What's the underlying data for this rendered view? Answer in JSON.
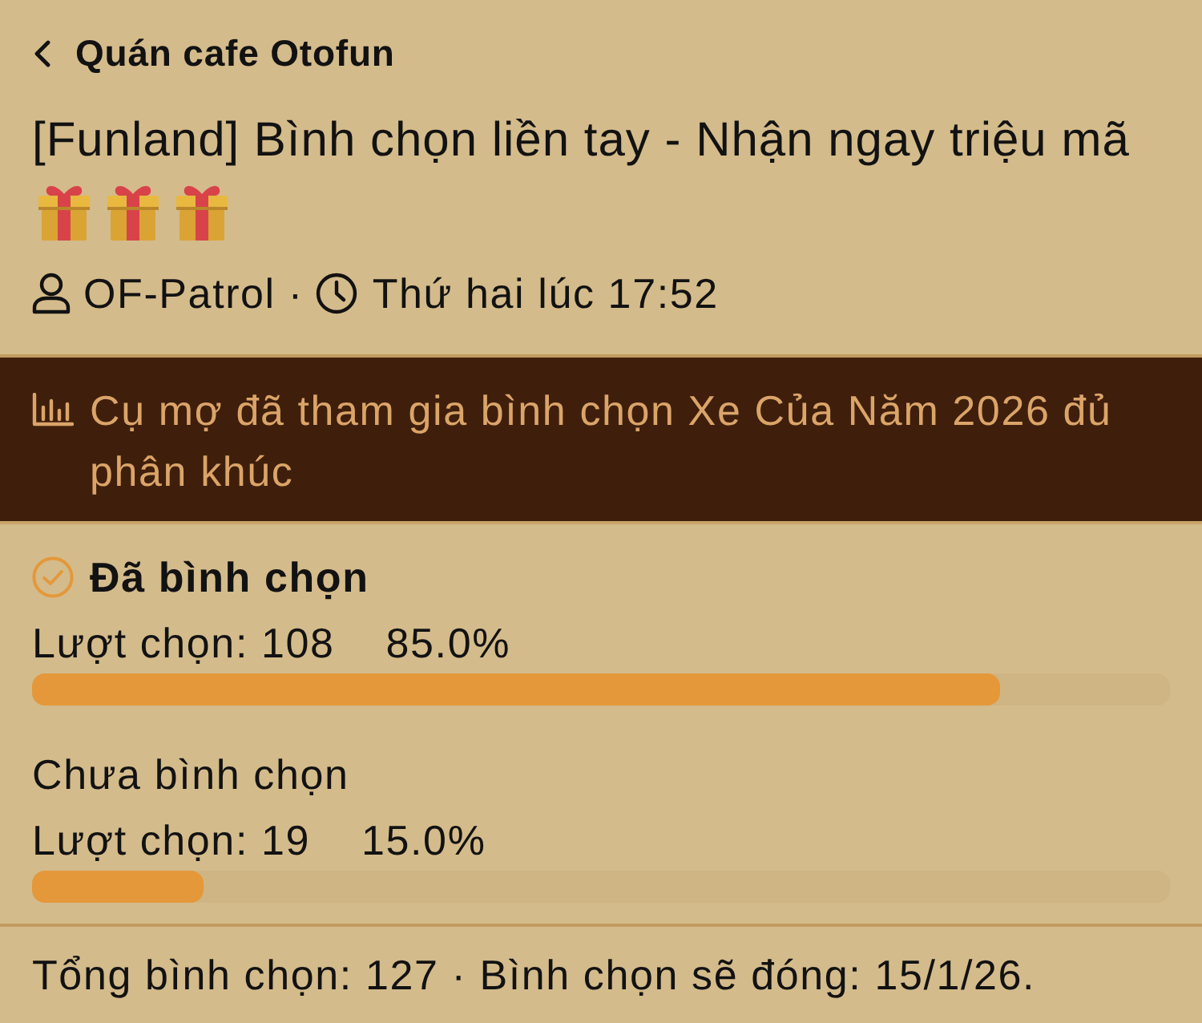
{
  "header": {
    "back_label": "Quán cafe Otofun"
  },
  "thread": {
    "title": "[Funland] Bình chọn liền tay - Nhận ngay triệu mã",
    "title_icons": [
      {
        "kind": "gift"
      },
      {
        "kind": "gift"
      },
      {
        "kind": "gift"
      }
    ],
    "author": "OF-Patrol",
    "separator": "·",
    "time": "Thứ hai lúc 17:52"
  },
  "poll": {
    "question": "Cụ mợ đã tham gia bình chọn Xe Của Năm 2026 đủ phân khúc",
    "options": [
      {
        "label": "Đã bình chọn",
        "voted": true,
        "count": "Lượt chọn: 108",
        "percent": "85.0%",
        "level": 0.85
      },
      {
        "label": "Chưa bình chọn",
        "voted": false,
        "count": "Lượt chọn: 19",
        "percent": "15.0%",
        "level": 0.15
      }
    ],
    "summary": "Tổng bình chọn: 127 · Bình chọn sẽ đóng: 15/1/26."
  }
}
